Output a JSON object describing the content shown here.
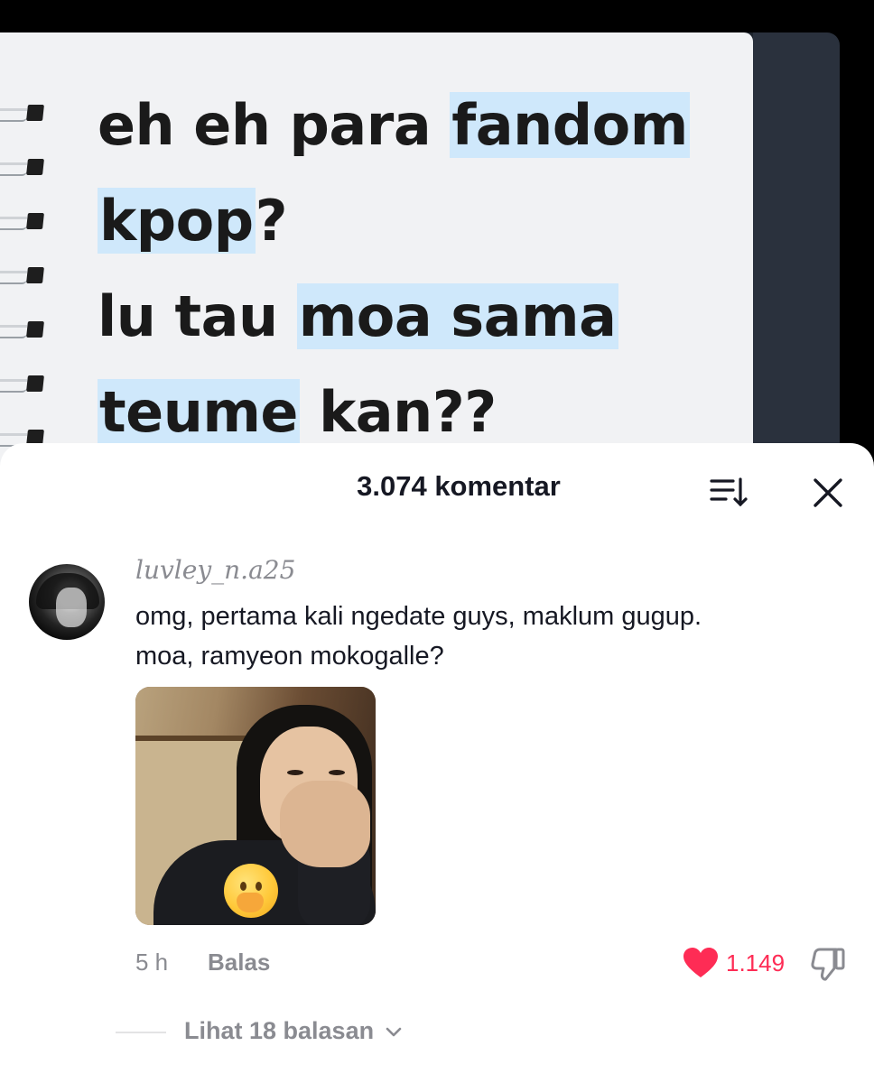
{
  "video": {
    "caption_lines": [
      {
        "parts": [
          {
            "text": "eh eh para ",
            "hl": false
          },
          {
            "text": "fandom",
            "hl": true
          }
        ]
      },
      {
        "parts": [
          {
            "text": "kpop",
            "hl": true
          },
          {
            "text": "?",
            "hl": false
          }
        ]
      },
      {
        "parts": [
          {
            "text": "lu tau ",
            "hl": false
          },
          {
            "text": "moa sama",
            "hl": true
          }
        ]
      },
      {
        "parts": [
          {
            "text": "teume",
            "hl": true
          },
          {
            "text": " kan??",
            "hl": false
          }
        ]
      }
    ],
    "highlight_color": "#cfe8fb"
  },
  "comments_panel": {
    "title": "3.074 komentar",
    "sort_icon": "sort-icon",
    "close_icon": "close-icon"
  },
  "comment": {
    "username": "luvley_n.a25",
    "text_lines": [
      "omg, pertama kali ngedate guys, maklum gugup.",
      "moa, ramyeon mokogalle?"
    ],
    "attached_image": "photo-of-person-covering-mouth",
    "sticker": "hand-over-mouth-emoji",
    "time": "5 h",
    "reply_label": "Balas",
    "like_count": "1.149",
    "liked": true,
    "like_color": "#fe2c55",
    "view_replies": "Lihat 18 balasan"
  }
}
